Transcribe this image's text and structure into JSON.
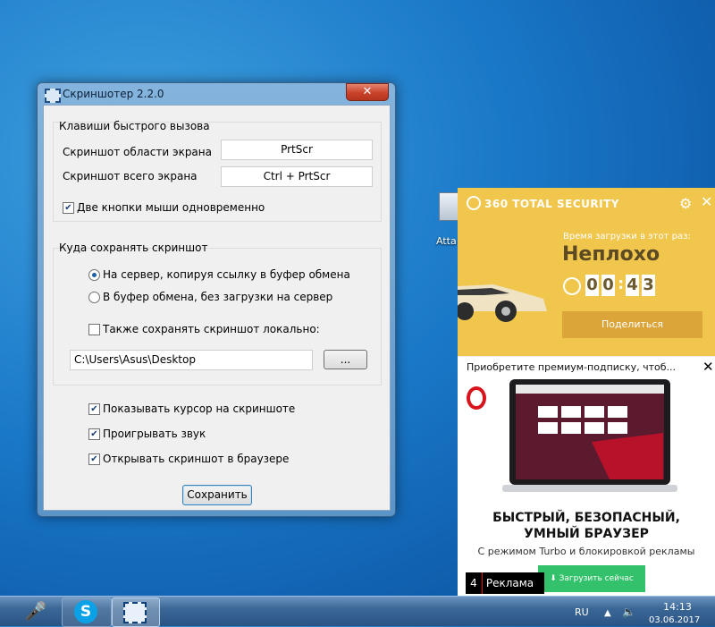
{
  "desktop": {
    "icon_label": "Atta"
  },
  "window": {
    "title": "Скриншотер 2.2.0",
    "close_glyph": "✕",
    "hotkeys": {
      "group_label": "Клавиши быстрого вызова",
      "area_label": "Скриншот области экрана",
      "area_value": "PrtScr",
      "full_label": "Скриншот всего экрана",
      "full_value": "Ctrl + PrtScr",
      "mouse_label": "Две кнопки мыши одновременно",
      "mouse_checked": true
    },
    "save": {
      "group_label": "Куда сохранять скриншот",
      "option_server": "На сервер, копируя ссылку в буфер обмена",
      "option_clipboard": "В буфер обмена, без загрузки на сервер",
      "selected": "server",
      "local_label": "Также сохранять скриншот локально:",
      "local_checked": false,
      "path_value": "C:\\Users\\Asus\\Desktop",
      "browse_label": "..."
    },
    "options": {
      "cursor_label": "Показывать курсор на скриншоте",
      "sound_label": "Проигрывать звук",
      "browser_label": "Открывать скриншот в браузере"
    },
    "save_button": "Сохранить",
    "check_glyph": "✔"
  },
  "ad": {
    "brand": "360 TOTAL SECURITY",
    "load_time_label": "Время загрузки в этот раз:",
    "rating": "Неплохо",
    "timer_digits": [
      "0",
      "0",
      "4",
      "3"
    ],
    "timer_colon": ":",
    "share_button": "Поделиться",
    "gear_glyph": "⚙",
    "close_glyph": "✕",
    "bar_text": "Приобретите премиум-подписку, чтоб...",
    "headline_1": "БЫСТРЫЙ, БЕЗОПАСНЫЙ,",
    "headline_2": "УМНЫЙ БРАУЗЕР",
    "subtext": "С режимом Turbo и блокировкой рекламы",
    "counter": "4",
    "ad_label": "Реклама",
    "download_button": "⬇  Загрузить сейчас",
    "colors": {
      "panel_yellow": "#f1c64d",
      "share_button": "#dca53a",
      "download_green": "#34c16b",
      "opera_red": "#d8151c"
    }
  },
  "taskbar": {
    "mic_icon": "🎤",
    "skype_glyph": "S",
    "language": "RU",
    "flag_glyph": "▲",
    "volume_glyph": "🔈",
    "time": "14:13",
    "date": "03.06.2017"
  }
}
